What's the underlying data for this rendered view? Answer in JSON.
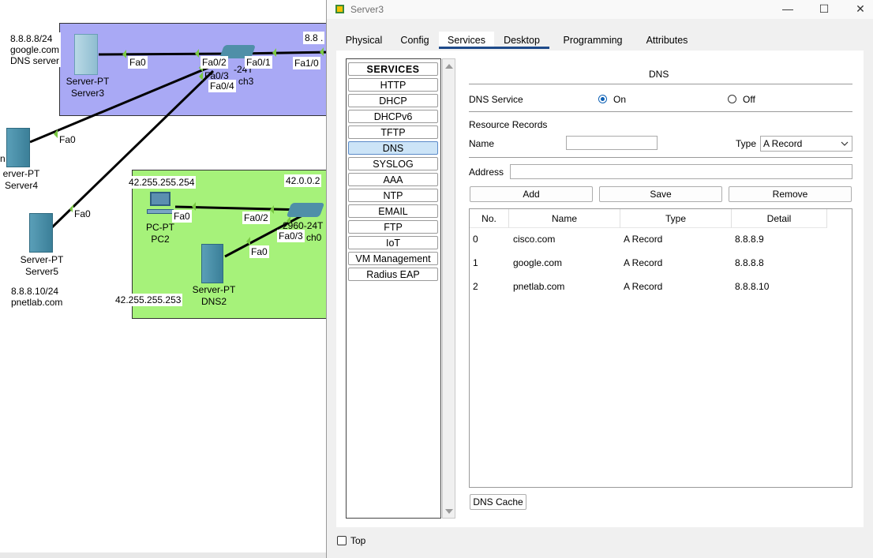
{
  "topology": {
    "server3_annot": [
      "8.8.8.8/24",
      "google.com",
      "DNS server"
    ],
    "server3_name": [
      "Server-PT",
      "Server3"
    ],
    "server4_name": [
      "erver-PT",
      "Server4"
    ],
    "server4_edge": "n",
    "server5_name": [
      "Server-PT",
      "Server5"
    ],
    "server5_annot": [
      "8.8.8.10/24",
      "pnetlab.com"
    ],
    "pc2_name": [
      "PC-PT",
      "PC2"
    ],
    "dns2_name": [
      "Server-PT",
      "DNS2"
    ],
    "ip_42_254": "42.255.255.254",
    "ip_42_253": "42.255.255.253",
    "ip_42_002": "42.0.0.2",
    "ip_888_cut": "8.8 .",
    "switch3_label": "-24T",
    "switch3_name": "ch3",
    "switch0_label": "2960-24T",
    "switch0_name": "ch0",
    "ports": {
      "s3_fa0": "Fa0",
      "sw3_fa02": "Fa0/2",
      "sw3_fa03": "Fa0/3",
      "sw3_fa04": "Fa0/4",
      "sw3_fa01": "Fa0/1",
      "fa10": "Fa1/0",
      "s4_fa0": "Fa0",
      "s5_fa0": "Fa0",
      "pc2_fa0": "Fa0",
      "sw0_fa02": "Fa0/2",
      "sw0_fa03": "Fa0/3",
      "dns2_fa0": "Fa0"
    },
    "colors": {
      "zone_blue": "#a9a9f5",
      "zone_green": "#a6f27a",
      "link": "#000000",
      "port_dot": "#7ac943"
    }
  },
  "window": {
    "title": "Server3",
    "controls": {
      "minimize": "—",
      "maximize": "☐",
      "close": "✕"
    },
    "tabs": [
      "Physical",
      "Config",
      "Services",
      "Desktop",
      "Programming",
      "Attributes"
    ],
    "active_tab": "Services",
    "services": [
      "SERVICES",
      "HTTP",
      "DHCP",
      "DHCPv6",
      "TFTP",
      "DNS",
      "SYSLOG",
      "AAA",
      "NTP",
      "EMAIL",
      "FTP",
      "IoT",
      "VM Management",
      "Radius EAP"
    ],
    "selected_service": "DNS",
    "dns": {
      "header": "DNS",
      "service_label": "DNS Service",
      "on_label": "On",
      "off_label": "Off",
      "service_state": "On",
      "records_label": "Resource Records",
      "name_label": "Name",
      "name_value": "",
      "type_label": "Type",
      "type_value": "A Record",
      "address_label": "Address",
      "address_value": "",
      "buttons": {
        "add": "Add",
        "save": "Save",
        "remove": "Remove"
      },
      "columns": [
        "No.",
        "Name",
        "Type",
        "Detail"
      ],
      "records": [
        {
          "no": "0",
          "name": "cisco.com",
          "type": "A Record",
          "detail": "8.8.8.9"
        },
        {
          "no": "1",
          "name": "google.com",
          "type": "A Record",
          "detail": "8.8.8.8"
        },
        {
          "no": "2",
          "name": "pnetlab.com",
          "type": "A Record",
          "detail": "8.8.8.10"
        }
      ],
      "cache_button": "DNS Cache"
    },
    "top_label": "Top",
    "top_checked": false,
    "colors": {
      "accent": "#1e4a8a",
      "selected_bg": "#cce4f7",
      "radio": "#0a5fb5"
    }
  }
}
